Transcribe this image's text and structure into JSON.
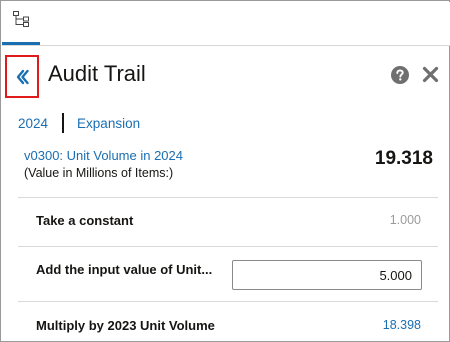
{
  "header": {
    "title": "Audit Trail",
    "back_icon": "chevron-double-left-icon",
    "help_icon": "help-icon",
    "close_icon": "close-icon"
  },
  "tab": {
    "icon": "hierarchy-icon"
  },
  "breadcrumb": {
    "items": [
      {
        "label": "2024"
      },
      {
        "label": "Expansion"
      }
    ]
  },
  "measure": {
    "name": "v0300: Unit Volume in 2024",
    "subtitle": "(Value in Millions of Items:)",
    "value": "19.318"
  },
  "steps": [
    {
      "label": "Take a constant",
      "value": "1.000",
      "kind": "readonly"
    },
    {
      "label": "Add the input value of Unit...",
      "value": "5.000",
      "kind": "input"
    },
    {
      "label": "Multiply by 2023 Unit Volume",
      "value": "18.398",
      "kind": "link"
    }
  ],
  "colors": {
    "accent": "#1a6fb3",
    "highlight_border": "#e01b1b",
    "muted_text": "#9b9b9b",
    "icon_gray": "#6f6f6f"
  }
}
